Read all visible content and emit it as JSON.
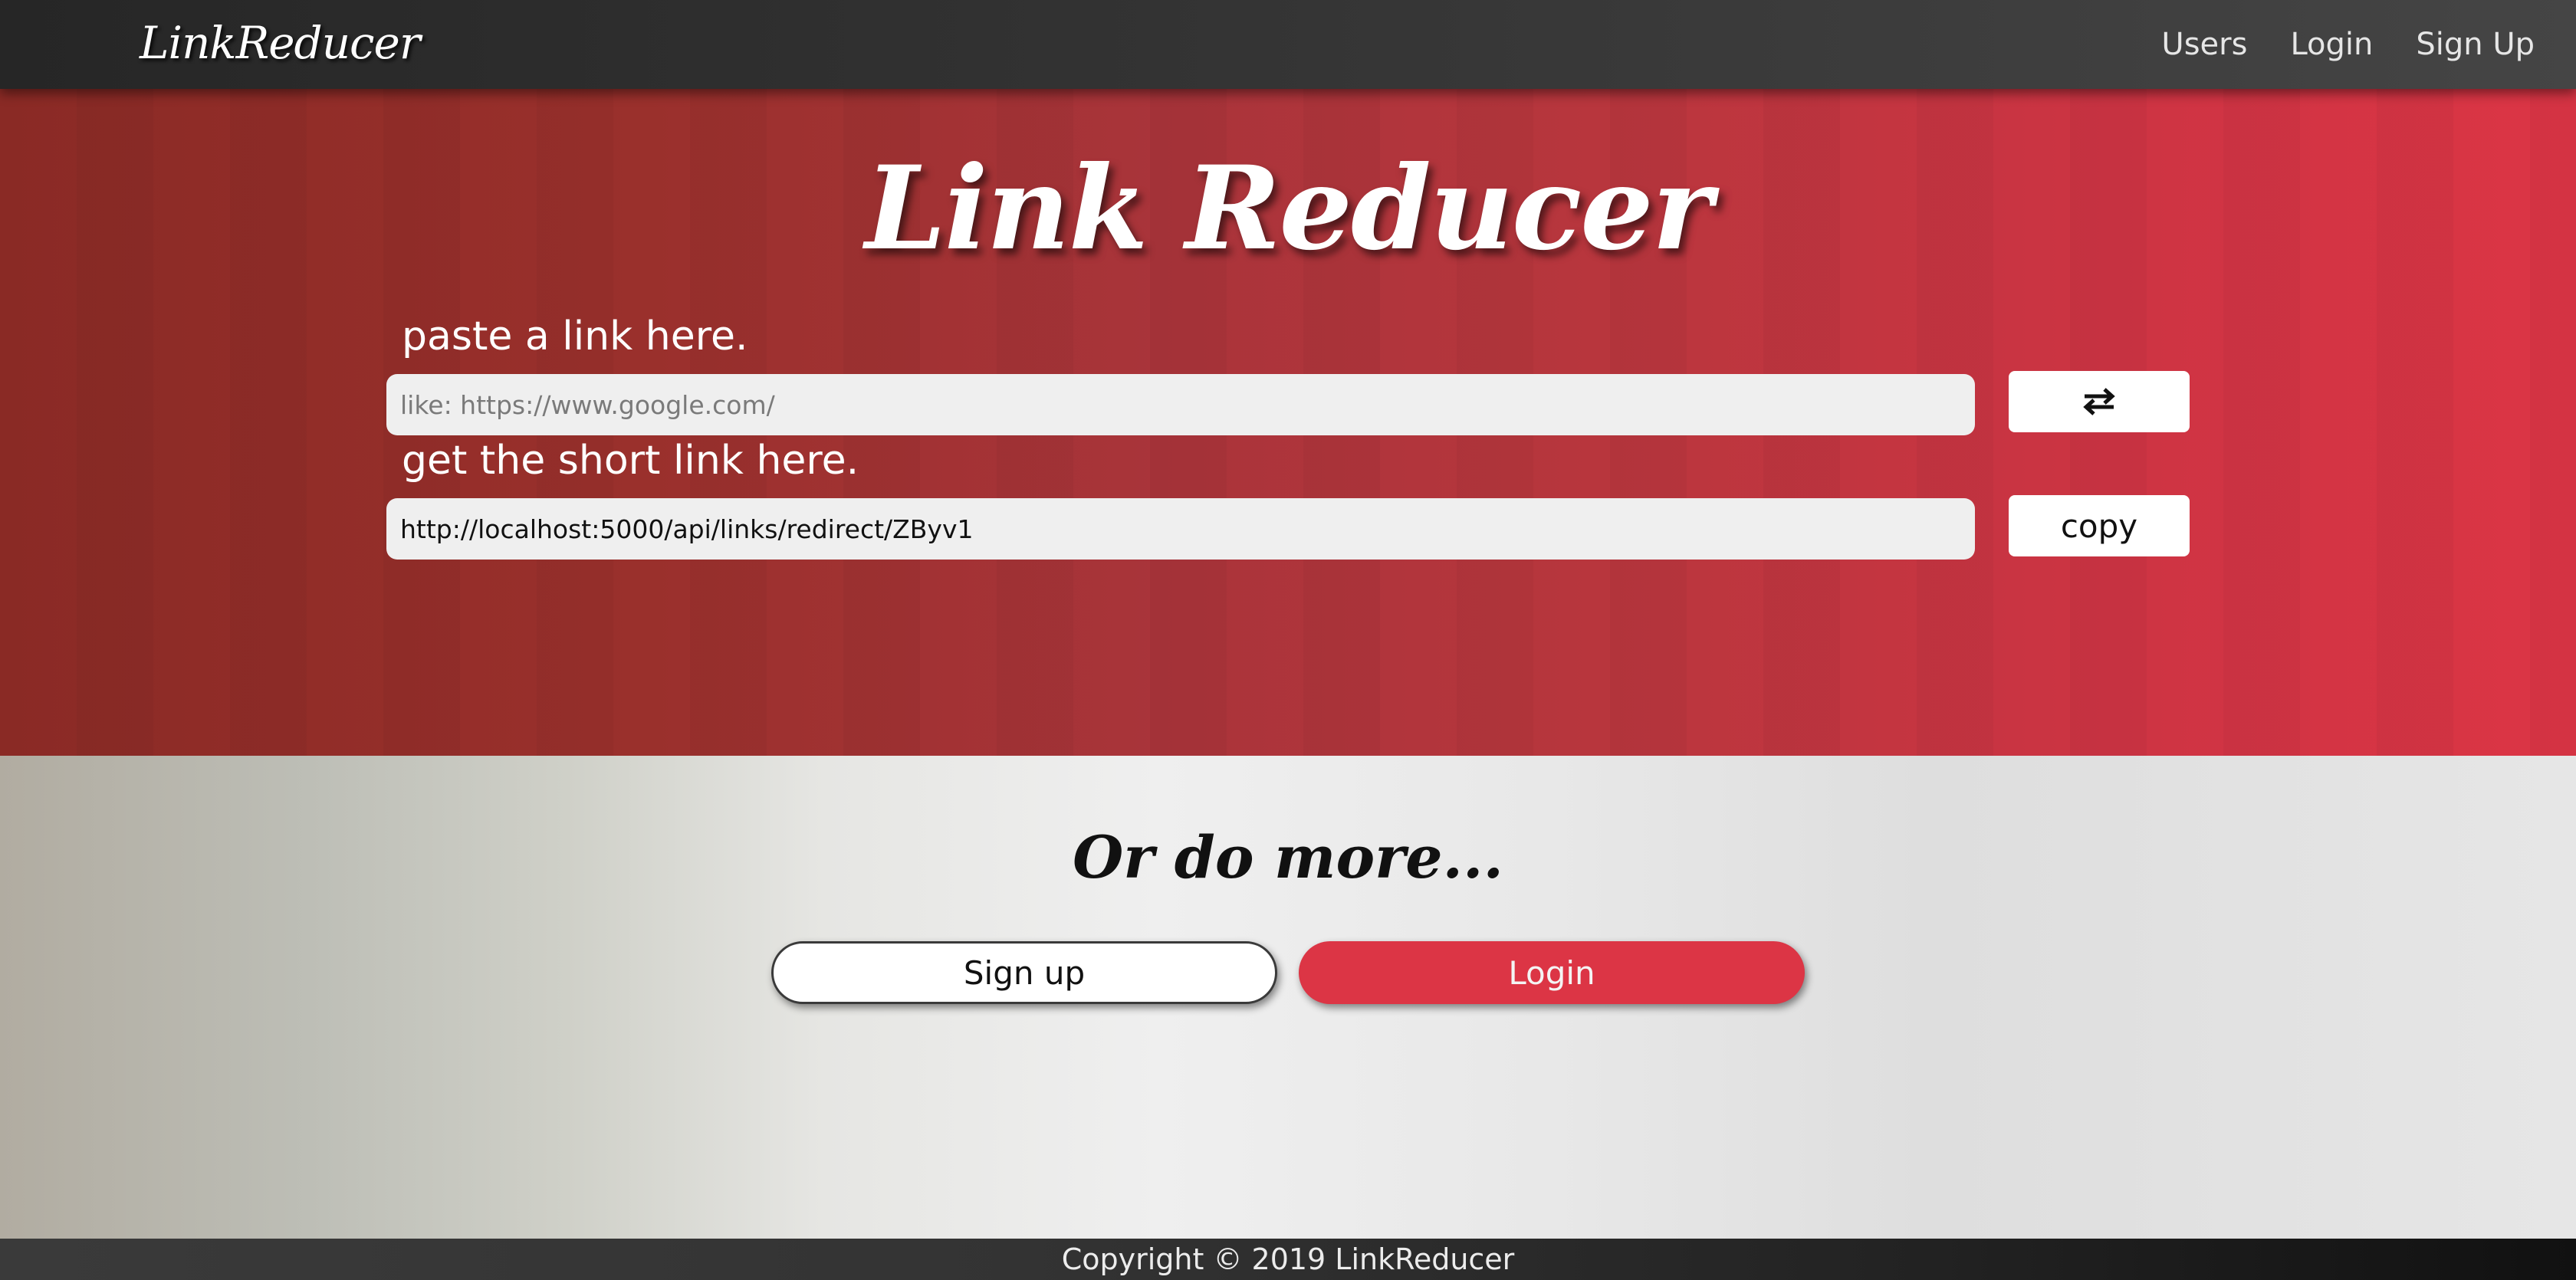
{
  "navbar": {
    "brand": "LinkReducer",
    "links": [
      {
        "label": "Users"
      },
      {
        "label": "Login"
      },
      {
        "label": "Sign Up"
      }
    ]
  },
  "hero": {
    "title": "Link Reducer",
    "paste_label": "paste a link here.",
    "paste_placeholder": "like: https://www.google.com/",
    "paste_value": "",
    "swap_icon": "swap-arrows-icon",
    "short_label": "get the short link here.",
    "short_value": "http://localhost:5000/api/links/redirect/ZByv1",
    "copy_label": "copy"
  },
  "more": {
    "title": "Or do more...",
    "signup_label": "Sign up",
    "login_label": "Login"
  },
  "footer": {
    "copyright": "Copyright © 2019 LinkReducer"
  },
  "colors": {
    "accent": "#dc3545",
    "navbar": "#333333",
    "footer": "#222222"
  }
}
